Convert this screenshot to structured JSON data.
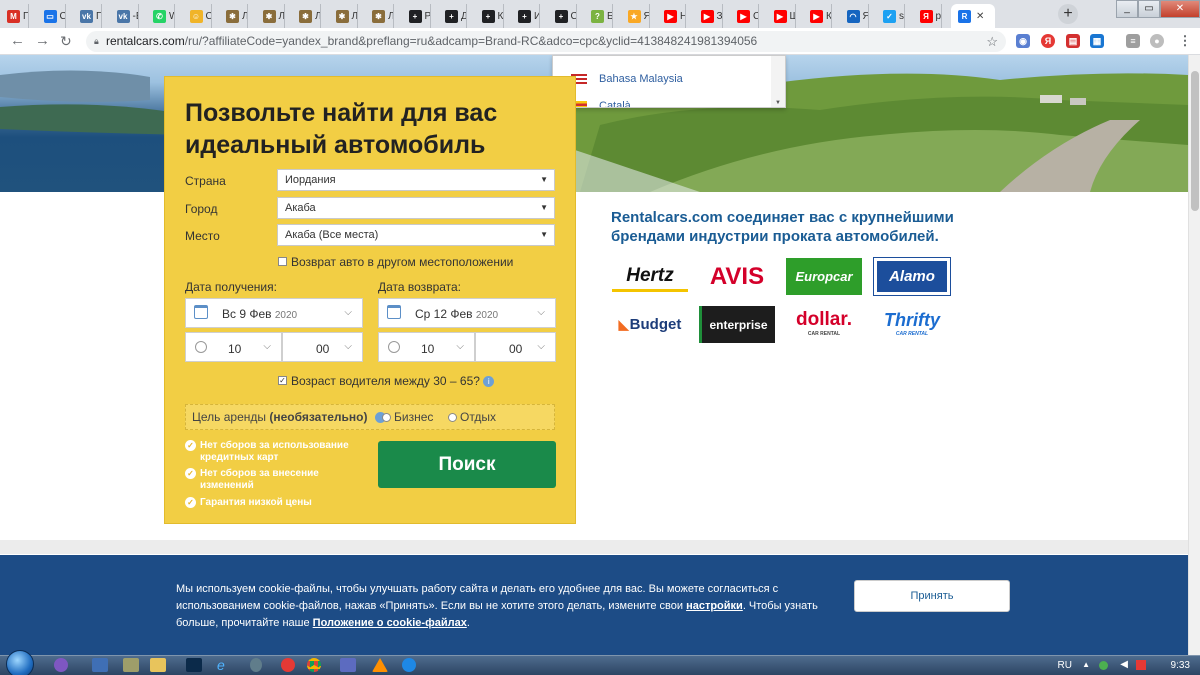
{
  "browser": {
    "tabs": [
      {
        "title": "П",
        "icon_name": "gmail-icon",
        "color": "#d93025",
        "glyph": "M"
      },
      {
        "title": "Сс",
        "icon_name": "chat-icon",
        "color": "#1a73e8",
        "glyph": "▭"
      },
      {
        "title": "П",
        "icon_name": "vk-icon",
        "color": "#4a76a8",
        "glyph": "vk"
      },
      {
        "title": "-Е",
        "icon_name": "vk-icon",
        "color": "#4a76a8",
        "glyph": "vk"
      },
      {
        "title": "W",
        "icon_name": "whatsapp-icon",
        "color": "#25d366",
        "glyph": "✆"
      },
      {
        "title": "Сс",
        "icon_name": "emoji-icon",
        "color": "#f0b429",
        "glyph": "☺"
      },
      {
        "title": "Л",
        "icon_name": "cat-icon",
        "color": "#8a6d3b",
        "glyph": "✱"
      },
      {
        "title": "Л",
        "icon_name": "cat-icon",
        "color": "#8a6d3b",
        "glyph": "✱"
      },
      {
        "title": "Л",
        "icon_name": "cat-icon",
        "color": "#8a6d3b",
        "glyph": "✱"
      },
      {
        "title": "Ли",
        "icon_name": "cat-icon",
        "color": "#8a6d3b",
        "glyph": "✱"
      },
      {
        "title": "Л",
        "icon_name": "cat-icon",
        "color": "#8a6d3b",
        "glyph": "✱"
      },
      {
        "title": "Ре",
        "icon_name": "plus-icon",
        "color": "#202124",
        "glyph": "+"
      },
      {
        "title": "Д",
        "icon_name": "plus-icon",
        "color": "#202124",
        "glyph": "+"
      },
      {
        "title": "К",
        "icon_name": "plus-icon",
        "color": "#202124",
        "glyph": "+"
      },
      {
        "title": "И",
        "icon_name": "plus-icon",
        "color": "#202124",
        "glyph": "+"
      },
      {
        "title": "Сі",
        "icon_name": "plus-icon",
        "color": "#202124",
        "glyph": "+"
      },
      {
        "title": "Бі",
        "icon_name": "question-icon",
        "color": "#7cb342",
        "glyph": "?"
      },
      {
        "title": "Я",
        "icon_name": "star-icon",
        "color": "#f9a825",
        "glyph": "★"
      },
      {
        "title": "Н",
        "icon_name": "youtube-icon",
        "color": "#ff0000",
        "glyph": "▶"
      },
      {
        "title": "Зі",
        "icon_name": "youtube-icon",
        "color": "#ff0000",
        "glyph": "▶"
      },
      {
        "title": "Сі",
        "icon_name": "youtube-icon",
        "color": "#ff0000",
        "glyph": "▶"
      },
      {
        "title": "Ш",
        "icon_name": "youtube-icon",
        "color": "#ff0000",
        "glyph": "▶"
      },
      {
        "title": "Кі",
        "icon_name": "youtube-icon",
        "color": "#ff0000",
        "glyph": "▶"
      },
      {
        "title": "Я",
        "icon_name": "arc-icon",
        "color": "#1565c0",
        "glyph": "◠"
      },
      {
        "title": "sa",
        "icon_name": "twitter-icon",
        "color": "#1da1f2",
        "glyph": "✓"
      },
      {
        "title": "ре",
        "icon_name": "yandex-icon",
        "color": "#ff0000",
        "glyph": "Я"
      },
      {
        "title": "",
        "icon_name": "rentalcars-icon",
        "color": "#1a73e8",
        "glyph": "R",
        "active": true
      }
    ],
    "url_host": "rentalcars.com",
    "url_rest": "/ru/?affiliateCode=yandex_brand&preflang=ru&adcamp=Brand-RC&adco=cpc&yclid=413848241981394056"
  },
  "form": {
    "title": "Позвольте найти для вас идеальный автомобиль",
    "country_label": "Страна",
    "country_value": "Иордания",
    "city_label": "Город",
    "city_value": "Акаба",
    "location_label": "Место",
    "location_value": "Акаба (Все места)",
    "return_other": "Возврат авто в другом местоположении",
    "pickup_label": "Дата получения:",
    "pickup_day": "Вс 9 Фев",
    "pickup_year": "2020",
    "return_label": "Дата возврата:",
    "return_day": "Ср 12 Фев",
    "return_year": "2020",
    "pickup_hour": "10",
    "pickup_min": "00",
    "return_hour": "10",
    "return_min": "00",
    "age_text": "Возраст водителя между 30 – 65?",
    "purpose_label": "Цель аренды",
    "purpose_optional": "(необязательно)",
    "purpose_business": "Бизнес",
    "purpose_leisure": "Отдых",
    "search_button": "Поиск",
    "perks": [
      "Нет сборов за использование кредитных карт",
      "Нет сборов за внесение изменений",
      "Гарантия низкой цены"
    ]
  },
  "tagline": "Rentalcars.com соединяет вас с крупнейшими брендами индустрии проката автомобилей.",
  "brands": [
    {
      "name": "Hertz",
      "color": "#111111",
      "bg": "#ffffff"
    },
    {
      "name": "AVIS",
      "color": "#d4002a",
      "bg": "#ffffff"
    },
    {
      "name": "Europcar",
      "color": "#ffffff",
      "bg": "#2e9e2a"
    },
    {
      "name": "Alamo",
      "color": "#ffffff",
      "bg": "#1c4e9c"
    },
    {
      "name": "Budget",
      "color": "#1d3d7a",
      "bg": "#ffffff"
    },
    {
      "name": "enterprise",
      "color": "#ffffff",
      "bg": "#1d1d1d"
    },
    {
      "name": "dollar.",
      "color": "#d4002a",
      "bg": "#ffffff",
      "sub": "CAR RENTAL"
    },
    {
      "name": "Thrifty",
      "color": "#1c6dd0",
      "bg": "#ffffff",
      "sub": "CAR RENTAL"
    }
  ],
  "languages": [
    {
      "name": "Bahasa Malaysia"
    },
    {
      "name": "Català"
    }
  ],
  "cookie": {
    "text_1": "Мы используем cookie-файлы, чтобы улучшать работу сайта и делать его удобнее для вас. Вы можете согласиться с использованием cookie-файлов, нажав «Принять». Если вы не хотите этого делать, измените свои ",
    "settings_link": "настройки",
    "text_2": ". Чтобы узнать больше, прочитайте наше ",
    "policy_link": "Положение о cookie-файлах",
    "text_3": ".",
    "accept": "Принять"
  },
  "taskbar": {
    "lang": "RU",
    "time": "9:33"
  },
  "colors": {
    "panel": "#f2ce44",
    "search_button": "#1a8a4a",
    "cookie_bg": "#1d4c86",
    "brand_blue": "#1a5c94"
  }
}
